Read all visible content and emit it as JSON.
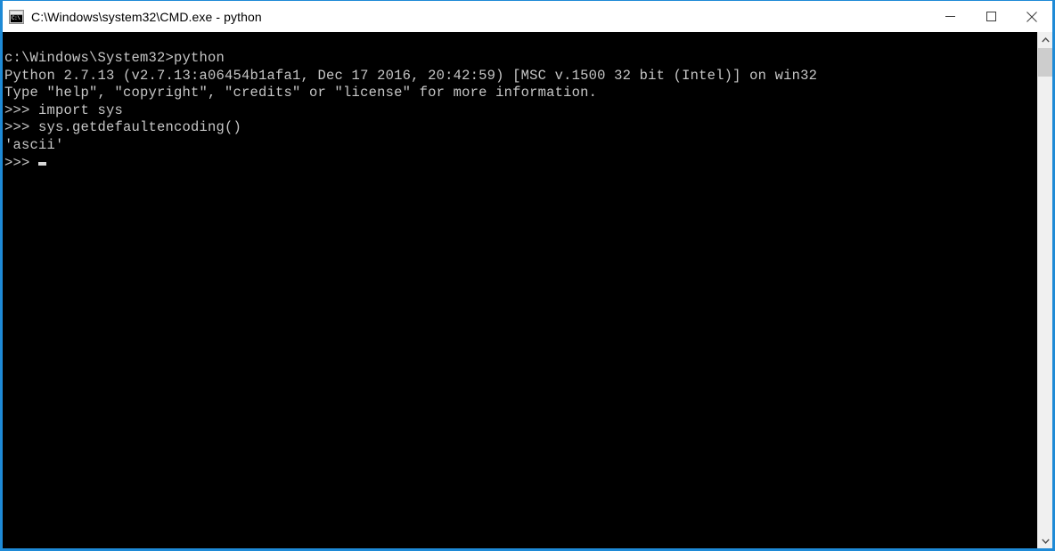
{
  "window": {
    "title": "C:\\Windows\\system32\\CMD.exe - python",
    "icon_name": "cmd-console-icon",
    "icon_glyph": "C:\\",
    "accent_color": "#1e8ad6",
    "titlebar_background": "#ffffff",
    "console_background": "#000000",
    "console_foreground": "#c6c6c6"
  },
  "window_controls": {
    "minimize_label": "Minimize",
    "maximize_label": "Maximize",
    "close_label": "Close"
  },
  "console": {
    "lines": [
      "c:\\Windows\\System32>python",
      "Python 2.7.13 (v2.7.13:a06454b1afa1, Dec 17 2016, 20:42:59) [MSC v.1500 32 bit (Intel)] on win32",
      "Type \"help\", \"copyright\", \"credits\" or \"license\" for more information.",
      ">>> import sys",
      ">>> sys.getdefaultencoding()",
      "'ascii'",
      ">>> "
    ],
    "prompt": ">>> ",
    "cursor_visible": true
  },
  "scrollbar": {
    "up_arrow": "∧",
    "down_arrow": "∨",
    "track_color": "#f0f0f0",
    "thumb_color": "#cdcdcd"
  }
}
